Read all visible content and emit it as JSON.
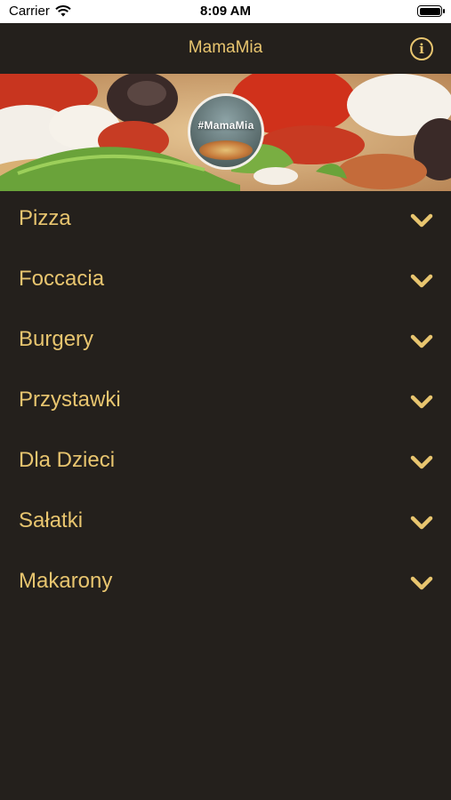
{
  "status_bar": {
    "carrier": "Carrier",
    "time": "8:09 AM"
  },
  "nav": {
    "title": "MamaMia",
    "info_icon": "info-icon"
  },
  "banner": {
    "logo_text": "#MamaMia"
  },
  "menu": {
    "items": [
      {
        "label": "Pizza"
      },
      {
        "label": "Foccacia"
      },
      {
        "label": "Burgery"
      },
      {
        "label": "Przystawki"
      },
      {
        "label": "Dla Dzieci"
      },
      {
        "label": "Sałatki"
      },
      {
        "label": "Makarony"
      }
    ]
  },
  "colors": {
    "accent": "#e8c56f",
    "background": "#24201c"
  }
}
